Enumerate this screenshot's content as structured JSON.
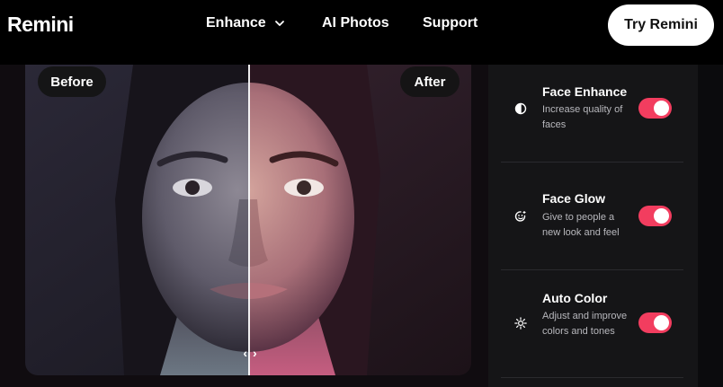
{
  "header": {
    "logo": "Remini",
    "nav": [
      {
        "label": "Enhance",
        "has_dropdown": true
      },
      {
        "label": "AI Photos"
      },
      {
        "label": "Support"
      }
    ],
    "cta": "Try Remini"
  },
  "compare": {
    "before_label": "Before",
    "after_label": "After",
    "handle_left": "‹",
    "handle_right": "›"
  },
  "features": [
    {
      "title": "Face Enhance",
      "description": "Increase quality of faces",
      "icon": "face-enhance-icon",
      "enabled": true
    },
    {
      "title": "Face Glow",
      "description": "Give to people a new look and feel",
      "icon": "face-glow-icon",
      "enabled": true
    },
    {
      "title": "Auto Color",
      "description": "Adjust and improve colors and tones",
      "icon": "sun-icon",
      "enabled": true
    }
  ],
  "colors": {
    "toggle_on": "#f23d5f",
    "background": "#0b0b0d",
    "panel": "#151517"
  }
}
